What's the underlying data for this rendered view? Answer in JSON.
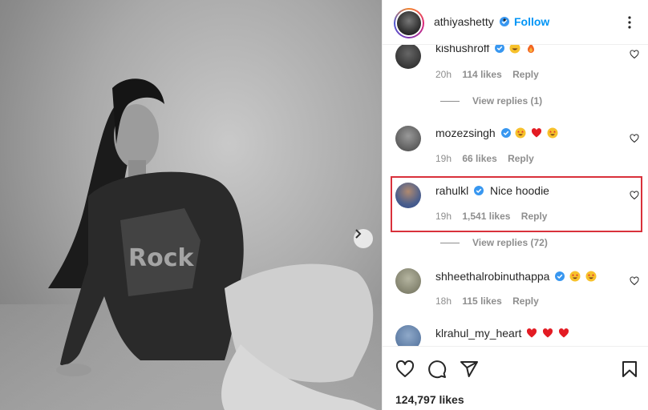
{
  "post": {
    "author": "athiyashetty",
    "follow_label": "Follow",
    "dot": "•",
    "likes_total": "124,797 likes"
  },
  "comments": [
    {
      "user": "kishushroff",
      "body": "",
      "time": "20h",
      "likes": "114 likes",
      "reply": "Reply",
      "emojis": [
        "grin",
        "fire"
      ],
      "verified": true
    },
    {
      "user": "mozezsingh",
      "body": "",
      "time": "19h",
      "likes": "66 likes",
      "reply": "Reply",
      "emojis": [
        "star-eyes",
        "heart",
        "star-eyes"
      ],
      "verified": true
    },
    {
      "user": "rahulkl",
      "body": "Nice hoodie",
      "time": "19h",
      "likes": "1,541 likes",
      "reply": "Reply",
      "emojis": [],
      "verified": true
    },
    {
      "user": "shheethalrobinuthappa",
      "body": "",
      "time": "18h",
      "likes": "115 likes",
      "reply": "Reply",
      "emojis": [
        "star-eyes",
        "star-eyes"
      ],
      "verified": true
    },
    {
      "user": "klrahul_my_heart",
      "body": "",
      "time": "",
      "likes": "",
      "reply": "",
      "emojis": [
        "heart",
        "heart",
        "heart"
      ],
      "verified": false
    }
  ],
  "view_replies": [
    "View replies (1)",
    "View replies (72)"
  ],
  "colors": {
    "accent": "#0095f6",
    "highlight": "#d9313b",
    "verified": "#3897f0"
  },
  "icons": [
    "verified-icon",
    "more-icon",
    "heart-icon",
    "comment-icon",
    "share-icon",
    "bookmark-icon",
    "chevron-right-icon"
  ]
}
